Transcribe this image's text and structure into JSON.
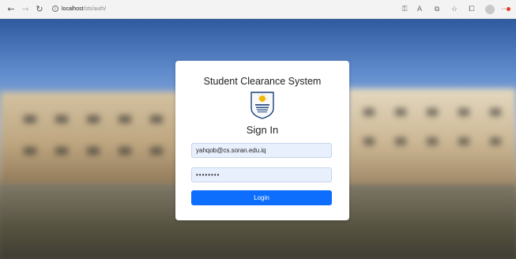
{
  "browser": {
    "address_host": "localhost",
    "address_path": "/sts/auth/",
    "info_glyph": "i"
  },
  "login": {
    "system_title": "Student Clearance System",
    "heading": "Sign In",
    "email_value": "yahqob@cs.soran.edu.iq",
    "password_mask": "••••••••",
    "button_label": "Login"
  },
  "icons": {
    "back": "arrow-left-icon",
    "forward": "arrow-right-icon",
    "reload": "reload-icon",
    "info": "info-icon",
    "logo": "soran-university-logo"
  },
  "colors": {
    "primary_button": "#0d6efd",
    "input_fill": "#e8f0fe",
    "card": "#ffffff"
  }
}
